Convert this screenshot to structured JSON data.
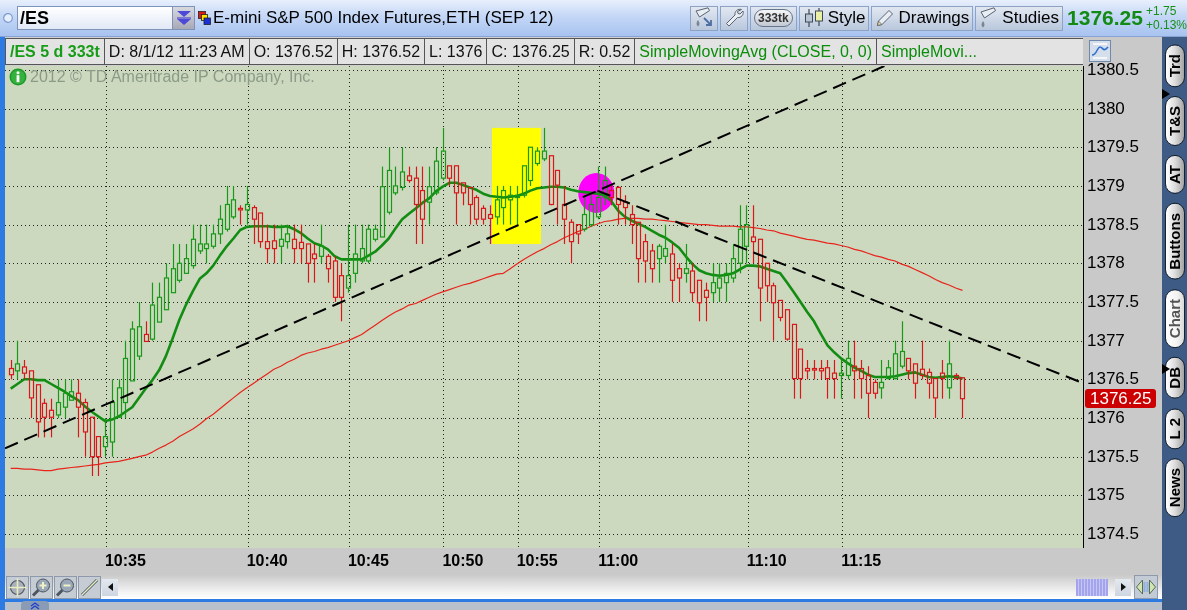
{
  "toolbar": {
    "symbol_field": {
      "value": "/ES"
    },
    "title": "E-mini S&P 500 Index Futures,ETH (SEP 12)",
    "buttons": [
      {
        "kind": "icon"
      },
      {
        "kind": "icon"
      },
      {
        "kind": "pill",
        "label": "333tk"
      },
      {
        "kind": "text",
        "label": "Style"
      },
      {
        "kind": "text",
        "label": "Drawings"
      },
      {
        "kind": "text",
        "label": "Studies"
      }
    ],
    "last_price": "1376.25",
    "change": "+1.75",
    "change_percent": "+0.13%"
  },
  "info_bar": {
    "cells": [
      {
        "kind": "symbol",
        "text": "/ES 5 d 333t"
      },
      {
        "kind": "quote",
        "text": "D: 8/1/12 11:23 AM"
      },
      {
        "kind": "quote",
        "text": "O: 1376.52"
      },
      {
        "kind": "quote",
        "text": "H: 1376.52"
      },
      {
        "kind": "quote",
        "text": "L: 1376"
      },
      {
        "kind": "quote",
        "text": "C: 1376.25"
      },
      {
        "kind": "quote",
        "text": "R: 0.52"
      },
      {
        "kind": "study",
        "text": "SimpleMovingAvg (CLOSE, 0, 0)"
      },
      {
        "kind": "study",
        "text": "SimpleMovi..."
      }
    ]
  },
  "chart": {
    "copyright": "2012 © TD Ameritrade IP Company, Inc.",
    "last_price_badge": "1376.25",
    "chart_data": {
      "type": "candlestick",
      "grid": true,
      "ylim": [
        1374.32,
        1380.55
      ],
      "yticks": [
        1374.5,
        1375,
        1375.5,
        1376,
        1376.5,
        1377,
        1377.5,
        1378,
        1378.5,
        1379,
        1379.5,
        1380,
        1380.5
      ],
      "categories": [
        null,
        null,
        null,
        null,
        null,
        null,
        null,
        null,
        null,
        null,
        null,
        null,
        null,
        null,
        null,
        null,
        null,
        "10:35",
        null,
        null,
        null,
        null,
        null,
        null,
        null,
        null,
        null,
        null,
        null,
        null,
        null,
        null,
        null,
        null,
        null,
        null,
        null,
        null,
        "10:40",
        null,
        null,
        null,
        null,
        null,
        null,
        null,
        null,
        null,
        null,
        null,
        null,
        null,
        null,
        "10:45",
        null,
        null,
        null,
        null,
        null,
        null,
        null,
        null,
        null,
        null,
        null,
        null,
        null,
        "10:50",
        null,
        null,
        null,
        null,
        null,
        null,
        null,
        null,
        null,
        null,
        "10:55",
        null,
        null,
        null,
        null,
        null,
        null,
        null,
        null,
        null,
        null,
        null,
        "11:00",
        null,
        null,
        null,
        null,
        null,
        null,
        null,
        null,
        null,
        null,
        null,
        null,
        null,
        null,
        null,
        null,
        null,
        null,
        null,
        null,
        null,
        "11:10",
        null,
        null,
        null,
        null,
        null,
        null,
        null,
        null,
        null,
        null,
        null,
        null,
        null,
        "11:15",
        null,
        null,
        null,
        null,
        null,
        null,
        null,
        null,
        null,
        null,
        null,
        null,
        null,
        null,
        null
      ],
      "ohlc": [
        [
          1376.64,
          1376.75,
          1376.5,
          1376.56
        ],
        [
          1376.61,
          1377.0,
          1376.5,
          1376.7
        ],
        [
          1376.66,
          1376.75,
          1376.5,
          1376.58
        ],
        [
          1376.61,
          1376.61,
          1376.0,
          1376.26
        ],
        [
          1376.43,
          1376.43,
          1375.75,
          1375.95
        ],
        [
          1376.19,
          1376.25,
          1375.75,
          1376.01
        ],
        [
          1376.1,
          1376.25,
          1375.75,
          1376.01
        ],
        [
          1376.04,
          1376.5,
          1376.0,
          1376.2
        ],
        [
          1376.14,
          1376.5,
          1376.0,
          1376.32
        ],
        [
          1376.23,
          1376.5,
          1376.23,
          1376.34
        ],
        [
          1376.32,
          1376.5,
          1375.75,
          1376.14
        ],
        [
          1376.2,
          1376.25,
          1375.5,
          1375.82
        ],
        [
          1376.01,
          1376.01,
          1375.25,
          1375.5
        ],
        [
          1375.76,
          1375.76,
          1375.25,
          1375.5
        ],
        [
          1375.63,
          1376.0,
          1375.5,
          1375.76
        ],
        [
          1375.69,
          1376.5,
          1375.5,
          1376.2
        ],
        [
          1376.01,
          1376.5,
          1376.0,
          1376.39
        ],
        [
          1376.2,
          1377.0,
          1376.0,
          1376.77
        ],
        [
          1376.48,
          1377.25,
          1376.48,
          1377.15
        ],
        [
          1376.8,
          1377.5,
          1376.75,
          1377.18
        ],
        [
          1377.08,
          1377.25,
          1376.99,
          1376.99
        ],
        [
          1377.02,
          1377.75,
          1377.0,
          1377.46
        ],
        [
          1377.24,
          1377.75,
          1377.24,
          1377.56
        ],
        [
          1377.4,
          1378.0,
          1377.4,
          1377.81
        ],
        [
          1377.62,
          1378.25,
          1377.62,
          1377.93
        ],
        [
          1377.78,
          1378.25,
          1377.75,
          1378.0
        ],
        [
          1377.87,
          1378.25,
          1377.87,
          1378.06
        ],
        [
          1377.97,
          1378.5,
          1377.93,
          1378.31
        ],
        [
          1378.16,
          1378.5,
          1378.12,
          1378.25
        ],
        [
          1378.19,
          1378.5,
          1378.0,
          1378.25
        ],
        [
          1378.22,
          1378.5,
          1378.19,
          1378.38
        ],
        [
          1378.38,
          1378.75,
          1378.25,
          1378.57
        ],
        [
          1378.44,
          1379.0,
          1378.41,
          1378.76
        ],
        [
          1378.6,
          1379.0,
          1378.57,
          1378.82
        ],
        [
          1378.71,
          1378.75,
          1378.5,
          1378.69
        ],
        [
          1378.69,
          1379.0,
          1378.5,
          1378.76
        ],
        [
          1378.72,
          1378.75,
          1378.25,
          1378.57
        ],
        [
          1378.65,
          1378.65,
          1378.2,
          1378.28
        ],
        [
          1378.28,
          1378.5,
          1378.0,
          1378.19
        ],
        [
          1378.29,
          1378.5,
          1378.0,
          1378.19
        ],
        [
          1378.22,
          1378.5,
          1378.0,
          1378.31
        ],
        [
          1378.28,
          1378.5,
          1378.19,
          1378.38
        ],
        [
          1378.31,
          1378.5,
          1378.0,
          1378.19
        ],
        [
          1378.27,
          1378.5,
          1378.0,
          1378.19
        ],
        [
          1378.25,
          1378.25,
          1377.75,
          1378.0
        ],
        [
          1378.12,
          1378.25,
          1377.75,
          1378.06
        ],
        [
          1378.09,
          1378.5,
          1378.0,
          1378.22
        ],
        [
          1378.09,
          1378.12,
          1377.75,
          1377.93
        ],
        [
          1378.03,
          1378.09,
          1377.5,
          1377.56
        ],
        [
          1377.84,
          1378.0,
          1377.25,
          1377.56
        ],
        [
          1377.68,
          1378.5,
          1377.62,
          1377.84
        ],
        [
          1377.87,
          1378.5,
          1377.75,
          1378.12
        ],
        [
          1378.03,
          1378.5,
          1378.0,
          1378.19
        ],
        [
          1378.03,
          1378.5,
          1378.0,
          1378.44
        ],
        [
          1378.31,
          1378.5,
          1378.28,
          1378.44
        ],
        [
          1378.34,
          1379.25,
          1378.34,
          1378.99
        ],
        [
          1378.66,
          1379.5,
          1378.63,
          1379.2
        ],
        [
          1378.91,
          1379.25,
          1378.88,
          1379.0
        ],
        [
          1378.98,
          1379.5,
          1378.94,
          1379.18
        ],
        [
          1379.13,
          1379.25,
          1379.04,
          1379.07
        ],
        [
          1379.1,
          1379.25,
          1378.25,
          1378.76
        ],
        [
          1378.94,
          1379.25,
          1378.25,
          1378.57
        ],
        [
          1378.79,
          1379.25,
          1378.5,
          1378.99
        ],
        [
          1378.91,
          1379.5,
          1378.88,
          1379.32
        ],
        [
          1379.1,
          1379.75,
          1379.07,
          1379.45
        ],
        [
          1379.26,
          1379.26,
          1379.0,
          1379.1
        ],
        [
          1379.26,
          1379.26,
          1378.5,
          1378.91
        ],
        [
          1379.04,
          1379.04,
          1378.75,
          1378.91
        ],
        [
          1378.98,
          1378.98,
          1378.5,
          1378.76
        ],
        [
          1378.85,
          1378.88,
          1378.5,
          1378.57
        ],
        [
          1378.71,
          1378.75,
          1378.5,
          1378.57
        ],
        [
          1378.63,
          1378.75,
          1378.25,
          1378.58
        ],
        [
          1378.6,
          1379.0,
          1378.5,
          1378.82
        ],
        [
          1378.72,
          1379.0,
          1378.5,
          1378.94
        ],
        [
          1378.82,
          1379.0,
          1378.5,
          1378.88
        ],
        [
          1378.85,
          1379.0,
          1378.5,
          1378.88
        ],
        [
          1378.88,
          1379.26,
          1378.85,
          1379.26
        ],
        [
          1379.07,
          1379.5,
          1379.0,
          1379.5
        ],
        [
          1379.29,
          1379.5,
          1379.26,
          1379.45
        ],
        [
          1379.35,
          1379.75,
          1379.32,
          1379.45
        ],
        [
          1379.39,
          1379.39,
          1378.75,
          1378.76
        ],
        [
          1379.2,
          1379.2,
          1378.5,
          1379.01
        ],
        [
          1378.76,
          1379.0,
          1378.25,
          1378.57
        ],
        [
          1378.53,
          1378.57,
          1378.0,
          1378.28
        ],
        [
          1378.5,
          1378.5,
          1378.25,
          1378.38
        ],
        [
          1378.44,
          1378.88,
          1378.41,
          1378.63
        ],
        [
          1378.5,
          1378.88,
          1378.47,
          1378.76
        ],
        [
          1378.6,
          1379.25,
          1378.57,
          1378.85
        ],
        [
          1378.85,
          1379.25,
          1378.75,
          1379.07
        ],
        [
          1378.94,
          1379.0,
          1378.75,
          1378.85
        ],
        [
          1378.98,
          1379.0,
          1378.5,
          1378.76
        ],
        [
          1378.79,
          1378.88,
          1378.5,
          1378.72
        ],
        [
          1378.63,
          1378.75,
          1378.25,
          1378.5
        ],
        [
          1378.53,
          1378.53,
          1377.75,
          1378.06
        ],
        [
          1378.28,
          1378.38,
          1377.75,
          1378.03
        ],
        [
          1378.16,
          1378.25,
          1377.75,
          1377.93
        ],
        [
          1378.06,
          1378.25,
          1377.75,
          1378.22
        ],
        [
          1378.09,
          1378.5,
          1378.0,
          1378.19
        ],
        [
          1378.12,
          1378.25,
          1377.5,
          1377.78
        ],
        [
          1377.93,
          1378.0,
          1377.5,
          1377.81
        ],
        [
          1377.87,
          1378.25,
          1377.75,
          1377.93
        ],
        [
          1377.9,
          1378.0,
          1377.5,
          1377.62
        ],
        [
          1377.78,
          1377.78,
          1377.25,
          1377.49
        ],
        [
          1377.65,
          1377.75,
          1377.25,
          1377.56
        ],
        [
          1377.62,
          1378.0,
          1377.5,
          1377.75
        ],
        [
          1377.68,
          1378.0,
          1377.5,
          1377.81
        ],
        [
          1377.75,
          1378.0,
          1377.5,
          1377.87
        ],
        [
          1377.81,
          1378.25,
          1377.75,
          1378.06
        ],
        [
          1378.0,
          1378.75,
          1377.87,
          1378.44
        ],
        [
          1378.22,
          1378.75,
          1378.0,
          1378.5
        ],
        [
          1378.34,
          1378.75,
          1378.0,
          1378.28
        ],
        [
          1378.31,
          1378.31,
          1377.25,
          1377.68
        ],
        [
          1378.0,
          1378.0,
          1377.5,
          1377.71
        ],
        [
          1377.71,
          1377.75,
          1377.0,
          1377.49
        ],
        [
          1377.52,
          1377.52,
          1377.25,
          1377.3
        ],
        [
          1377.4,
          1377.4,
          1377.0,
          1377.02
        ],
        [
          1377.21,
          1377.21,
          1376.25,
          1376.51
        ],
        [
          1376.89,
          1376.89,
          1376.25,
          1376.51
        ],
        [
          1376.64,
          1376.75,
          1376.5,
          1376.61
        ],
        [
          1376.64,
          1376.75,
          1376.5,
          1376.62
        ],
        [
          1376.64,
          1376.75,
          1376.5,
          1376.61
        ],
        [
          1376.65,
          1376.75,
          1376.25,
          1376.51
        ],
        [
          1376.58,
          1376.75,
          1376.25,
          1376.51
        ],
        [
          1376.55,
          1376.75,
          1376.25,
          1376.58
        ],
        [
          1376.55,
          1377.0,
          1376.5,
          1376.77
        ],
        [
          1376.67,
          1377.0,
          1376.25,
          1376.61
        ],
        [
          1376.64,
          1376.75,
          1376.25,
          1376.51
        ],
        [
          1376.55,
          1376.67,
          1376.0,
          1376.32
        ],
        [
          1376.46,
          1376.5,
          1376.25,
          1376.32
        ],
        [
          1376.39,
          1376.75,
          1376.25,
          1376.46
        ],
        [
          1376.51,
          1376.75,
          1376.5,
          1376.65
        ],
        [
          1376.51,
          1377.0,
          1376.5,
          1376.83
        ],
        [
          1376.67,
          1377.25,
          1376.64,
          1376.86
        ],
        [
          1376.77,
          1376.77,
          1376.5,
          1376.61
        ],
        [
          1376.7,
          1376.7,
          1376.25,
          1376.45
        ],
        [
          1376.63,
          1377.0,
          1376.5,
          1376.55
        ],
        [
          1376.59,
          1376.64,
          1376.25,
          1376.45
        ],
        [
          1376.51,
          1376.51,
          1376.0,
          1376.26
        ],
        [
          1376.58,
          1376.75,
          1376.25,
          1376.51
        ],
        [
          1376.39,
          1377.0,
          1376.25,
          1376.7
        ],
        [
          1376.55,
          1376.58,
          1376.5,
          1376.51
        ],
        [
          1376.52,
          1376.52,
          1376.0,
          1376.25
        ]
      ],
      "series": [
        {
          "type": "line",
          "color": "#e8241c",
          "values": [
            1375.35,
            1375.35,
            1375.34,
            1375.34,
            1375.33,
            1375.32,
            1375.32,
            1375.34,
            1375.35,
            1375.36,
            1375.37,
            1375.38,
            1375.39,
            1375.4,
            1375.42,
            1375.43,
            1375.44,
            1375.46,
            1375.48,
            1375.5,
            1375.52,
            1375.56,
            1375.61,
            1375.65,
            1375.7,
            1375.76,
            1375.81,
            1375.86,
            1375.92,
            1375.99,
            1376.05,
            1376.12,
            1376.19,
            1376.26,
            1376.33,
            1376.39,
            1376.45,
            1376.51,
            1376.57,
            1376.63,
            1376.67,
            1376.72,
            1376.76,
            1376.81,
            1376.84,
            1376.86,
            1376.89,
            1376.91,
            1376.94,
            1376.97,
            1377.0,
            1377.04,
            1377.08,
            1377.14,
            1377.2,
            1377.26,
            1377.32,
            1377.37,
            1377.41,
            1377.46,
            1377.48,
            1377.52,
            1377.56,
            1377.6,
            1377.63,
            1377.66,
            1377.69,
            1377.72,
            1377.74,
            1377.77,
            1377.8,
            1377.83,
            1377.86,
            1377.87,
            1377.93,
            1377.99,
            1378.05,
            1378.1,
            1378.15,
            1378.19,
            1378.24,
            1378.28,
            1378.33,
            1378.37,
            1378.41,
            1378.44,
            1378.48,
            1378.51,
            1378.54,
            1378.55,
            1378.57,
            1378.58,
            1378.58,
            1378.58,
            1378.57,
            1378.57,
            1378.56,
            1378.55,
            1378.54,
            1378.53,
            1378.52,
            1378.51,
            1378.5,
            1378.5,
            1378.49,
            1378.48,
            1378.48,
            1378.48,
            1378.47,
            1378.47,
            1378.46,
            1378.45,
            1378.43,
            1378.42,
            1378.39,
            1378.37,
            1378.35,
            1378.33,
            1378.31,
            1378.3,
            1378.28,
            1378.26,
            1378.25,
            1378.23,
            1378.21,
            1378.18,
            1378.16,
            1378.13,
            1378.1,
            1378.08,
            1378.05,
            1378.03,
            1377.99,
            1377.96,
            1377.92,
            1377.88,
            1377.84,
            1377.79,
            1377.75,
            1377.72,
            1377.68,
            1377.65
          ]
        },
        {
          "type": "line",
          "color": "#128c12",
          "values": [
            1376.38,
            1376.44,
            1376.5,
            1376.5,
            1376.49,
            1376.49,
            1376.44,
            1376.39,
            1376.34,
            1376.28,
            1376.23,
            1376.15,
            1376.08,
            1376.02,
            1375.96,
            1375.98,
            1376.02,
            1376.08,
            1376.14,
            1376.26,
            1376.38,
            1376.49,
            1376.62,
            1376.8,
            1377.03,
            1377.27,
            1377.47,
            1377.64,
            1377.8,
            1377.87,
            1377.97,
            1378.1,
            1378.22,
            1378.32,
            1378.43,
            1378.47,
            1378.48,
            1378.48,
            1378.48,
            1378.47,
            1378.47,
            1378.48,
            1378.44,
            1378.39,
            1378.32,
            1378.26,
            1378.23,
            1378.18,
            1378.09,
            1378.05,
            1378.05,
            1378.05,
            1378.05,
            1378.1,
            1378.15,
            1378.23,
            1378.32,
            1378.45,
            1378.57,
            1378.64,
            1378.71,
            1378.78,
            1378.84,
            1378.93,
            1378.99,
            1379.04,
            1379.04,
            1379.01,
            1378.98,
            1378.95,
            1378.9,
            1378.87,
            1378.86,
            1378.85,
            1378.86,
            1378.87,
            1378.9,
            1378.94,
            1378.97,
            1378.98,
            1378.99,
            1378.99,
            1378.98,
            1378.95,
            1378.93,
            1378.92,
            1378.91,
            1378.9,
            1378.88,
            1378.8,
            1378.68,
            1378.6,
            1378.55,
            1378.51,
            1378.47,
            1378.42,
            1378.37,
            1378.33,
            1378.27,
            1378.2,
            1378.09,
            1377.99,
            1377.91,
            1377.87,
            1377.85,
            1377.84,
            1377.85,
            1377.87,
            1377.92,
            1377.97,
            1377.97,
            1377.96,
            1377.93,
            1377.9,
            1377.87,
            1377.75,
            1377.63,
            1377.5,
            1377.37,
            1377.25,
            1377.09,
            1376.94,
            1376.85,
            1376.77,
            1376.71,
            1376.65,
            1376.61,
            1376.56,
            1376.53,
            1376.53,
            1376.53,
            1376.54,
            1376.56,
            1376.58,
            1376.59,
            1376.56,
            1376.53,
            1376.52,
            1376.53,
            1376.54,
            1376.53,
            1376.51
          ]
        }
      ]
    }
  },
  "side_tabs": [
    {
      "label": "Trd",
      "selected": false
    },
    {
      "label": "T&S",
      "selected": false
    },
    {
      "label": "AT",
      "selected": false
    },
    {
      "label": "Buttons",
      "selected": false
    },
    {
      "label": "Chart",
      "selected": true
    },
    {
      "label": "DB",
      "selected": false
    },
    {
      "label": "L 2",
      "selected": false
    },
    {
      "label": "News",
      "selected": false
    }
  ]
}
